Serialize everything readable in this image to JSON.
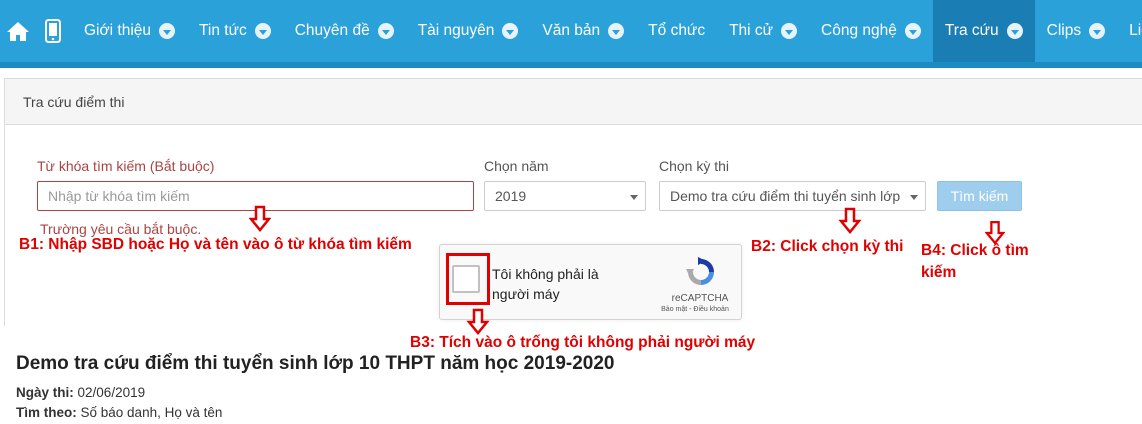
{
  "nav": {
    "items": [
      {
        "label": "Giới thiệu",
        "has_dropdown": true,
        "active": false
      },
      {
        "label": "Tin tức",
        "has_dropdown": true,
        "active": false
      },
      {
        "label": "Chuyên đề",
        "has_dropdown": true,
        "active": false
      },
      {
        "label": "Tài nguyên",
        "has_dropdown": true,
        "active": false
      },
      {
        "label": "Văn bản",
        "has_dropdown": true,
        "active": false
      },
      {
        "label": "Tổ chức",
        "has_dropdown": false,
        "active": false
      },
      {
        "label": "Thi cử",
        "has_dropdown": true,
        "active": false
      },
      {
        "label": "Công nghệ",
        "has_dropdown": true,
        "active": false
      },
      {
        "label": "Tra cứu",
        "has_dropdown": true,
        "active": true
      },
      {
        "label": "Clips",
        "has_dropdown": true,
        "active": false
      },
      {
        "label": "Liên hệ",
        "has_dropdown": false,
        "active": false
      }
    ],
    "icons": {
      "home": "home-icon",
      "mobile": "mobile-phone-icon",
      "dropdown": "chevron-down-circle-icon"
    }
  },
  "panel": {
    "title": "Tra cứu điểm thi"
  },
  "form": {
    "keyword_label": "Từ khóa tìm kiếm (Bắt buộc)",
    "keyword_placeholder": "Nhập từ khóa tìm kiếm",
    "keyword_value": "",
    "keyword_error": "Trường yêu cầu bắt buộc.",
    "year_label": "Chọn năm",
    "year_value": "2019",
    "exam_label": "Chọn kỳ thi",
    "exam_value": "Demo tra cứu điểm thi tuyển sinh lớp",
    "search_button": "Tìm kiếm"
  },
  "recaptcha": {
    "text": "Tôi không phải là người máy",
    "brand": "reCAPTCHA",
    "links": "Bảo mật - Điều khoản",
    "checked": false
  },
  "annotations": {
    "b1": "B1:  Nhập SBD hoặc Họ và tên vào ô từ khóa tìm kiếm",
    "b2": "B2:  Click chọn kỳ thi",
    "b3": "B3:  Tích vào ô trống tôi không phải người máy",
    "b4_line1": "B4: Click ô tìm",
    "b4_line2": "kiếm",
    "color": "#e00000"
  },
  "exam": {
    "title": "Demo tra cứu điểm thi tuyển sinh lớp 10 THPT năm học 2019-2020",
    "date_label": "Ngày thi:",
    "date_value": "02/06/2019",
    "search_by_label": "Tìm theo:",
    "search_by_value": "Số báo danh, Họ và tên"
  },
  "colors": {
    "nav_bg": "#2aa1d8",
    "nav_active": "#1a7db3",
    "error": "#a94442",
    "button": "#9fcdee"
  }
}
